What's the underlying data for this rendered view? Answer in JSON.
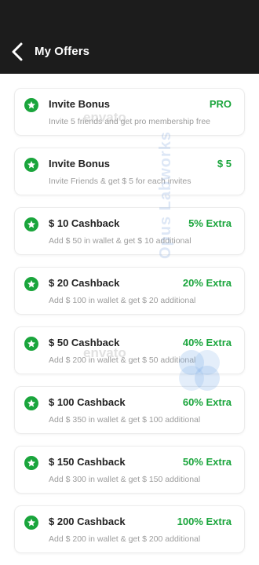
{
  "header": {
    "title": "My Offers"
  },
  "offers": [
    {
      "title": "Invite Bonus",
      "badge": "PRO",
      "description": "Invite 5 friends and get pro membership free"
    },
    {
      "title": "Invite Bonus",
      "badge": "$ 5",
      "description": "Invite Friends & get $ 5 for each invites"
    },
    {
      "title": "$ 10 Cashback",
      "badge": "5% Extra",
      "description": "Add $ 50 in wallet & get $ 10 additional"
    },
    {
      "title": "$ 20 Cashback",
      "badge": "20% Extra",
      "description": "Add $ 100 in wallet & get $ 20 additional"
    },
    {
      "title": "$ 50 Cashback",
      "badge": "40% Extra",
      "description": "Add $ 200 in wallet & get $ 50 additional"
    },
    {
      "title": "$ 100 Cashback",
      "badge": "60% Extra",
      "description": "Add $ 350 in wallet & get $ 100 additional"
    },
    {
      "title": "$ 150 Cashback",
      "badge": "50% Extra",
      "description": "Add $ 300 in wallet & get $ 150 additional"
    },
    {
      "title": "$ 200 Cashback",
      "badge": "100% Extra",
      "description": "Add $ 200 in wallet & get $ 200 additional"
    }
  ],
  "watermark": {
    "brand": "envato",
    "author": "Opus Labworks"
  },
  "colors": {
    "header_bg": "#1c1c1c",
    "accent": "#1aa53c",
    "title_text": "#222222",
    "muted_text": "#9c9c9c"
  },
  "icons": {
    "back": "chevron-left-icon",
    "offer": "star-icon"
  }
}
